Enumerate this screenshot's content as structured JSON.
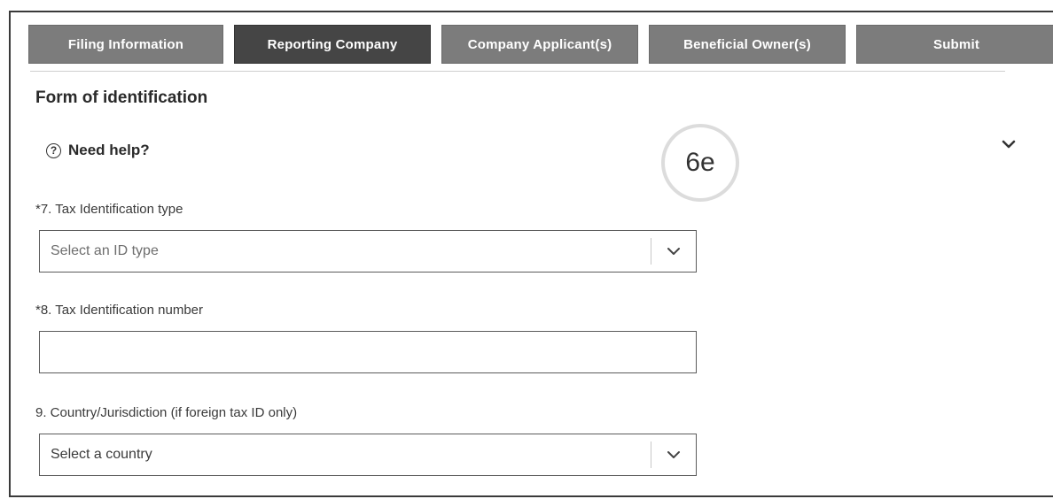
{
  "tabs": [
    {
      "label": "Filing Information",
      "active": false
    },
    {
      "label": "Reporting Company",
      "active": true
    },
    {
      "label": "Company Applicant(s)",
      "active": false
    },
    {
      "label": "Beneficial Owner(s)",
      "active": false
    },
    {
      "label": "Submit",
      "active": false
    }
  ],
  "section": {
    "title": "Form of identification"
  },
  "help": {
    "icon": "question-circle-icon",
    "label": "Need help?"
  },
  "badge": {
    "text": "6e"
  },
  "fields": {
    "tax_id_type": {
      "label": "*7. Tax Identification type",
      "placeholder": "Select an ID type"
    },
    "tax_id_number": {
      "label": "*8. Tax Identification number",
      "value": ""
    },
    "country": {
      "label": "9. Country/Jurisdiction (if foreign tax ID only)",
      "placeholder": "Select a country"
    }
  },
  "colors": {
    "tab_inactive": "#7c7c7c",
    "tab_active": "#454545"
  }
}
